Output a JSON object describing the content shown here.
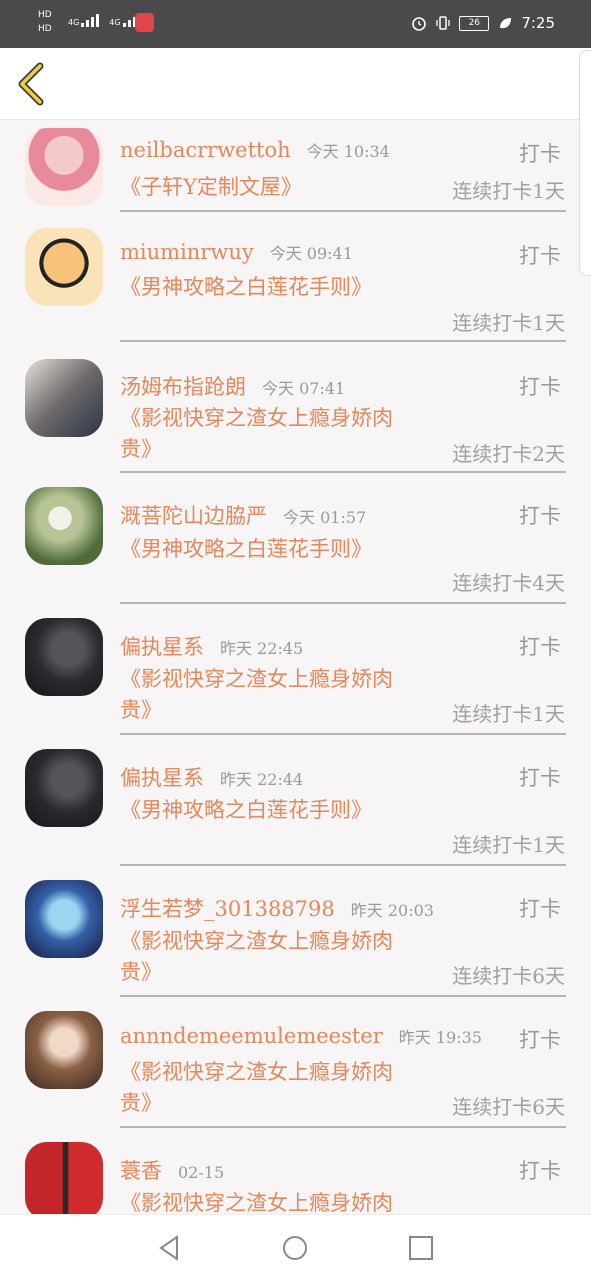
{
  "statusbar": {
    "hd1": "HD",
    "hd2": "HD",
    "net1": "4G",
    "net2": "4G",
    "battery": "26",
    "time": "7:25"
  },
  "header": {
    "back_icon": "chevron-left-icon"
  },
  "items": [
    {
      "name": "neilbacrrwettoh",
      "time": "今天 10:34",
      "action": "打卡",
      "book": "《子轩Y定制文屋》",
      "streak": "连续打卡1天",
      "avatar": "pink-hair-anime-girl"
    },
    {
      "name": "miuminrwuy",
      "time": "今天 09:41",
      "action": "打卡",
      "book": "《男神攻略之白莲花手则》",
      "streak": "连续打卡1天",
      "avatar": "cartoon-face"
    },
    {
      "name": "汤姆布指跄朗",
      "time": "今天 07:41",
      "action": "打卡",
      "book": "《影视快穿之渣女上瘾身娇肉贵》",
      "streak": "连续打卡2天",
      "avatar": "two-people-photo"
    },
    {
      "name": "溉菩陀山边脇严",
      "time": "今天 01:57",
      "action": "打卡",
      "book": "《男神攻略之白莲花手则》",
      "streak": "连续打卡4天",
      "avatar": "dandelion"
    },
    {
      "name": "偏执星系",
      "time": "昨天 22:45",
      "action": "打卡",
      "book": "《影视快穿之渣女上瘾身娇肉贵》",
      "streak": "连续打卡1天",
      "avatar": "dark-portrait"
    },
    {
      "name": "偏执星系",
      "time": "昨天 22:44",
      "action": "打卡",
      "book": "《男神攻略之白莲花手则》",
      "streak": "连续打卡1天",
      "avatar": "dark-portrait"
    },
    {
      "name": "浮生若梦_301388798",
      "time": "昨天 20:03",
      "action": "打卡",
      "book": "《影视快穿之渣女上瘾身娇肉贵》",
      "streak": "连续打卡6天",
      "avatar": "blue-anime-girl"
    },
    {
      "name": "annndemeemulemeester",
      "time": "昨天 19:35",
      "action": "打卡",
      "book": "《影视快穿之渣女上瘾身娇肉贵》",
      "streak": "连续打卡6天",
      "avatar": "curly-hair-girl"
    },
    {
      "name": "蓑香",
      "time": "02-15",
      "action": "打卡",
      "book": "《影视快穿之渣女上瘾身娇肉贵》",
      "streak": "",
      "avatar": "wedding-couple"
    }
  ],
  "navbar": {
    "back": "back-triangle-icon",
    "home": "home-circle-icon",
    "recent": "recent-square-icon"
  },
  "colors": {
    "accent": "#e8875a",
    "muted": "#9a9a9a",
    "statusbar": "#4a4a4a",
    "back_arrow": "#f0d040"
  }
}
